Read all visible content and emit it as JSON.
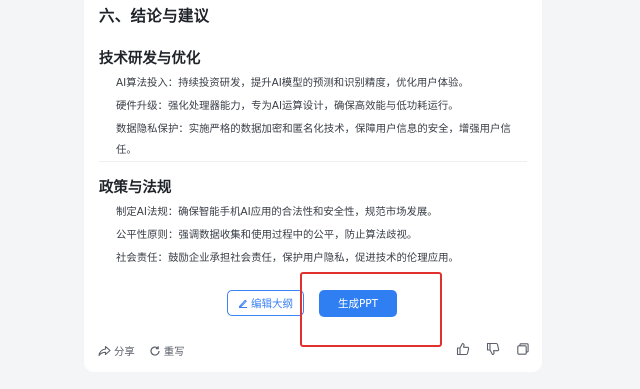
{
  "section": {
    "title": "六、结论与建议",
    "groups": [
      {
        "heading": "技术研发与优化",
        "items": [
          "AI算法投入：持续投资研发，提升AI模型的预测和识别精度，优化用户体验。",
          "硬件升级：强化处理器能力，专为AI运算设计，确保高效能与低功耗运行。",
          "数据隐私保护：实施严格的数据加密和匿名化技术，保障用户信息的安全，增强用户信任。"
        ]
      },
      {
        "heading": "政策与法规",
        "items": [
          "制定AI法规：确保智能手机AI应用的合法性和安全性，规范市场发展。",
          "公平性原则：强调数据收集和使用过程中的公平，防止算法歧视。",
          "社会责任：鼓励企业承担社会责任，保护用户隐私，促进技术的伦理应用。"
        ]
      }
    ]
  },
  "actions": {
    "edit_outline": "编辑大纲",
    "generate_ppt": "生成PPT"
  },
  "footer": {
    "share": "分享",
    "rewrite": "重写"
  },
  "colors": {
    "accent": "#2f7ff3",
    "highlight_box": "#e0312f"
  }
}
